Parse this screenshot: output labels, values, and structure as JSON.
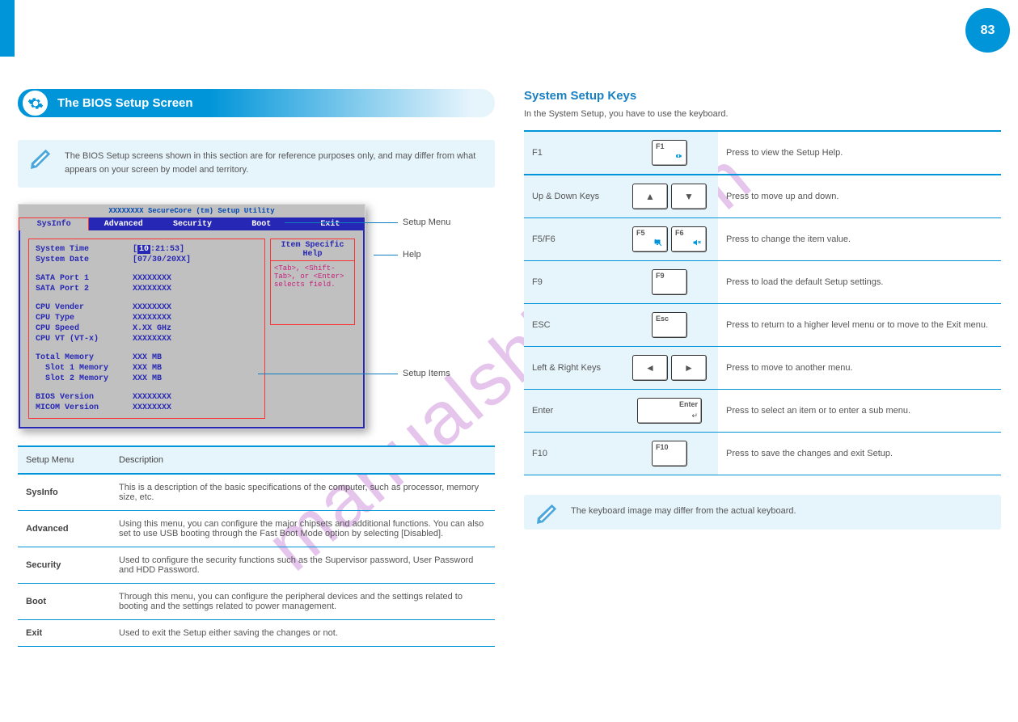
{
  "page_number": "83",
  "watermark": "manualshive.com",
  "header": {
    "title": "The BIOS Setup Screen"
  },
  "note1": "The BIOS Setup screens shown in this section are for reference purposes only, and may differ from what appears on your screen by model and territory.",
  "bios": {
    "title": "XXXXXXXX SecureCore (tm) Setup Utility",
    "tabs": [
      "SysInfo",
      "Advanced",
      "Security",
      "Boot",
      "Exit"
    ],
    "help_title": "Item Specific Help",
    "help_body": "<Tab>, <Shift-Tab>, or <Enter> selects field.",
    "rows": [
      {
        "k": "System Time",
        "v": "[10:21:53]",
        "highlight": "10"
      },
      {
        "k": "System Date",
        "v": "[07/30/20XX]"
      },
      {
        "sep": true
      },
      {
        "k": "SATA Port 1",
        "v": "XXXXXXXX"
      },
      {
        "k": "SATA Port 2",
        "v": "XXXXXXXX"
      },
      {
        "sep": true
      },
      {
        "k": "CPU Vender",
        "v": "XXXXXXXX"
      },
      {
        "k": "CPU Type",
        "v": "XXXXXXXX"
      },
      {
        "k": "CPU Speed",
        "v": "X.XX GHz"
      },
      {
        "k": "CPU VT (VT-x)",
        "v": "XXXXXXXX"
      },
      {
        "sep": true
      },
      {
        "k": "Total Memory",
        "v": "XXX MB"
      },
      {
        "k": "Slot 1 Memory",
        "v": "XXX MB",
        "sub": true
      },
      {
        "k": "Slot 2 Memory",
        "v": "XXX MB",
        "sub": true
      },
      {
        "sep": true
      },
      {
        "k": "BIOS Version",
        "v": "XXXXXXXX"
      },
      {
        "k": "MICOM Version",
        "v": "XXXXXXXX"
      }
    ]
  },
  "callouts": {
    "menu": "Setup Menu",
    "help": "Help",
    "items": "Setup Items"
  },
  "setup_menus": {
    "head_menu": "Setup Menu",
    "head_desc": "Description",
    "rows": [
      {
        "menu": "SysInfo",
        "desc": "This is a description of the basic specifications of the computer, such as processor, memory size, etc."
      },
      {
        "menu": "Advanced",
        "desc": "Using this menu, you can configure the major chipsets and additional functions. You can also set to use USB booting through the Fast Boot Mode option by selecting [Disabled]."
      },
      {
        "menu": "Security",
        "desc": "Used to configure the security functions such as the Supervisor password, User Password and HDD Password."
      },
      {
        "menu": "Boot",
        "desc": "Through this menu, you can configure the peripheral devices and the settings related to booting and the settings related to power management."
      },
      {
        "menu": "Exit",
        "desc": "Used to exit the Setup either saving the changes or not."
      }
    ]
  },
  "right": {
    "heading": "System Setup Keys",
    "sub": "In the System Setup, you have to use the keyboard.",
    "rows": [
      {
        "label": "F1",
        "keys": [
          "F1"
        ],
        "desc": "Press to view the Setup Help."
      },
      {
        "label": "Up & Down Keys",
        "keys": [
          "UP",
          "DOWN"
        ],
        "desc": "Press to move up and down."
      },
      {
        "label": "F5/F6",
        "keys": [
          "F5",
          "F6"
        ],
        "desc": "Press to change the item value."
      },
      {
        "label": "F9",
        "keys": [
          "F9"
        ],
        "desc": "Press to load the default Setup settings."
      },
      {
        "label": "ESC",
        "keys": [
          "ESC"
        ],
        "desc": "Press to return to a higher level menu or to move to the Exit menu."
      },
      {
        "label": "Left & Right Keys",
        "keys": [
          "LEFT",
          "RIGHT"
        ],
        "desc": "Press to move to another menu."
      },
      {
        "label": "Enter",
        "keys": [
          "ENTER"
        ],
        "desc": "Press to select an item or to enter a sub menu."
      },
      {
        "label": "F10",
        "keys": [
          "F10"
        ],
        "desc": "Press to save the changes and exit Setup."
      }
    ]
  },
  "note2": "The keyboard image may differ from the actual keyboard."
}
